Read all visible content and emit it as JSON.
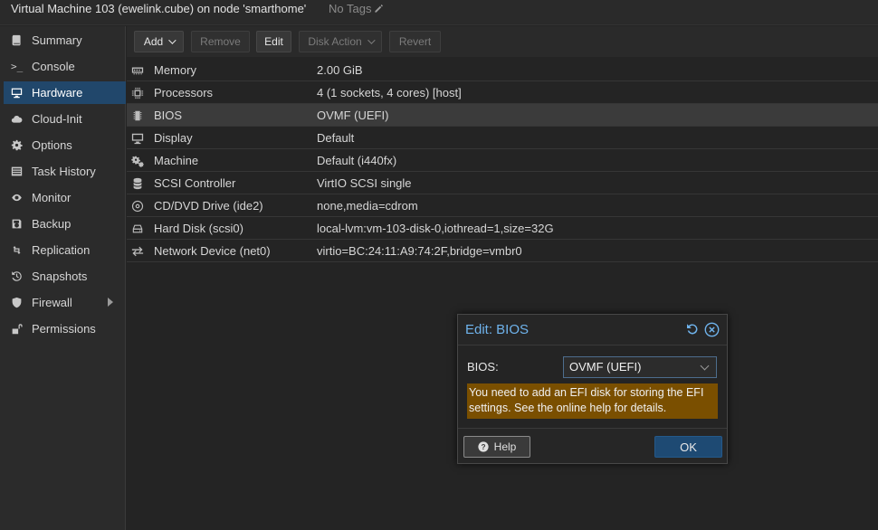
{
  "header": {
    "title": "Virtual Machine 103 (ewelink.cube) on node 'smarthome'",
    "tags": "No Tags",
    "tags_icon": "pencil-icon"
  },
  "sidebar": {
    "items": [
      {
        "label": "Summary",
        "icon": "book-icon"
      },
      {
        "label": "Console",
        "icon": "terminal-icon"
      },
      {
        "label": "Hardware",
        "icon": "desktop-icon",
        "active": true
      },
      {
        "label": "Cloud-Init",
        "icon": "cloud-icon"
      },
      {
        "label": "Options",
        "icon": "gear-icon"
      },
      {
        "label": "Task History",
        "icon": "list-icon"
      },
      {
        "label": "Monitor",
        "icon": "eye-icon"
      },
      {
        "label": "Backup",
        "icon": "floppy-icon"
      },
      {
        "label": "Replication",
        "icon": "retweet-icon"
      },
      {
        "label": "Snapshots",
        "icon": "history-icon"
      },
      {
        "label": "Firewall",
        "icon": "shield-icon",
        "has_submenu": true
      },
      {
        "label": "Permissions",
        "icon": "unlock-icon"
      }
    ]
  },
  "toolbar": {
    "add": "Add",
    "remove": "Remove",
    "edit": "Edit",
    "disk_action": "Disk Action",
    "revert": "Revert"
  },
  "hardware": [
    {
      "name": "Memory",
      "value": "2.00 GiB",
      "icon": "memory-icon"
    },
    {
      "name": "Processors",
      "value": "4 (1 sockets, 4 cores) [host]",
      "icon": "cpu-icon"
    },
    {
      "name": "BIOS",
      "value": "OVMF (UEFI)",
      "icon": "microchip-icon",
      "selected": true
    },
    {
      "name": "Display",
      "value": "Default",
      "icon": "monitor-icon"
    },
    {
      "name": "Machine",
      "value": "Default (i440fx)",
      "icon": "cogs-icon"
    },
    {
      "name": "SCSI Controller",
      "value": "VirtIO SCSI single",
      "icon": "database-icon"
    },
    {
      "name": "CD/DVD Drive (ide2)",
      "value": "none,media=cdrom",
      "icon": "cdrom-icon"
    },
    {
      "name": "Hard Disk (scsi0)",
      "value": "local-lvm:vm-103-disk-0,iothread=1,size=32G",
      "icon": "hdd-icon"
    },
    {
      "name": "Network Device (net0)",
      "value": "virtio=BC:24:11:A9:74:2F,bridge=vmbr0",
      "icon": "exchange-icon"
    }
  ],
  "dialog": {
    "title": "Edit: BIOS",
    "field_label": "BIOS:",
    "field_value": "OVMF (UEFI)",
    "warning": "You need to add an EFI disk for storing the EFI settings. See the online help for details.",
    "help_label": "Help",
    "ok_label": "OK",
    "accent_color": "#6fb3ec",
    "warning_color": "#7a4f00"
  }
}
